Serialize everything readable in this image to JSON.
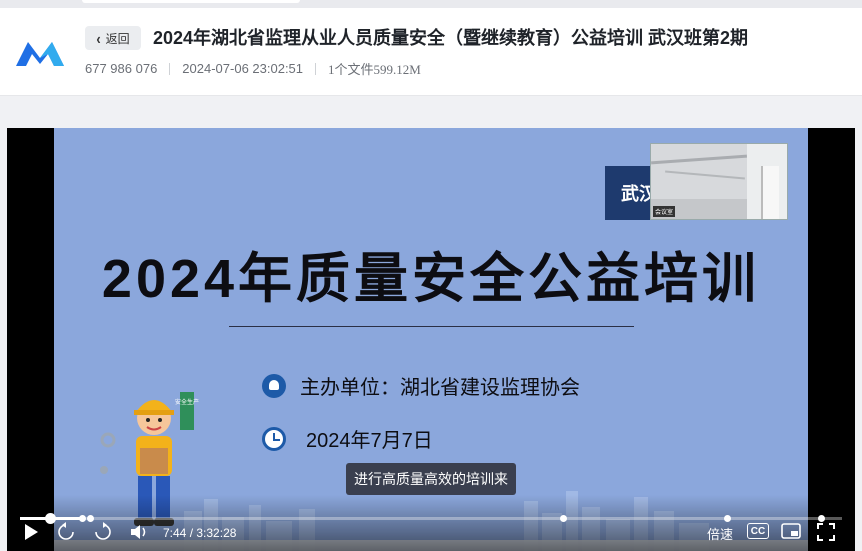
{
  "header": {
    "back_label": "返回",
    "title": "2024年湖北省监理从业人员质量安全（暨继续教育）公益培训 武汉班第2期",
    "meeting_id": "677 986 076",
    "datetime": "2024-07-06 23:02:51",
    "files": "1个文件599.12M"
  },
  "slide": {
    "badge": "武汉",
    "title": "2024年质量安全公益培训",
    "organizer": "主办单位：湖北省建设监理协会",
    "date": "2024年7月7日",
    "worker_sign": "安全生产"
  },
  "player": {
    "subtitle": "进行高质量高效的培训来",
    "current_time": "7:44",
    "duration": "3:32:28",
    "speed_label": "倍速",
    "cc_label": "CC",
    "progress_fraction": 0.036,
    "buffered_fraction": 0.075,
    "chapter_marks": [
      0.075,
      0.085,
      0.66,
      0.86,
      0.975
    ]
  },
  "colors": {
    "accent": "#1d5aa8",
    "slide_bg": "#8ba7dc",
    "badge": "#1e3a6e"
  }
}
